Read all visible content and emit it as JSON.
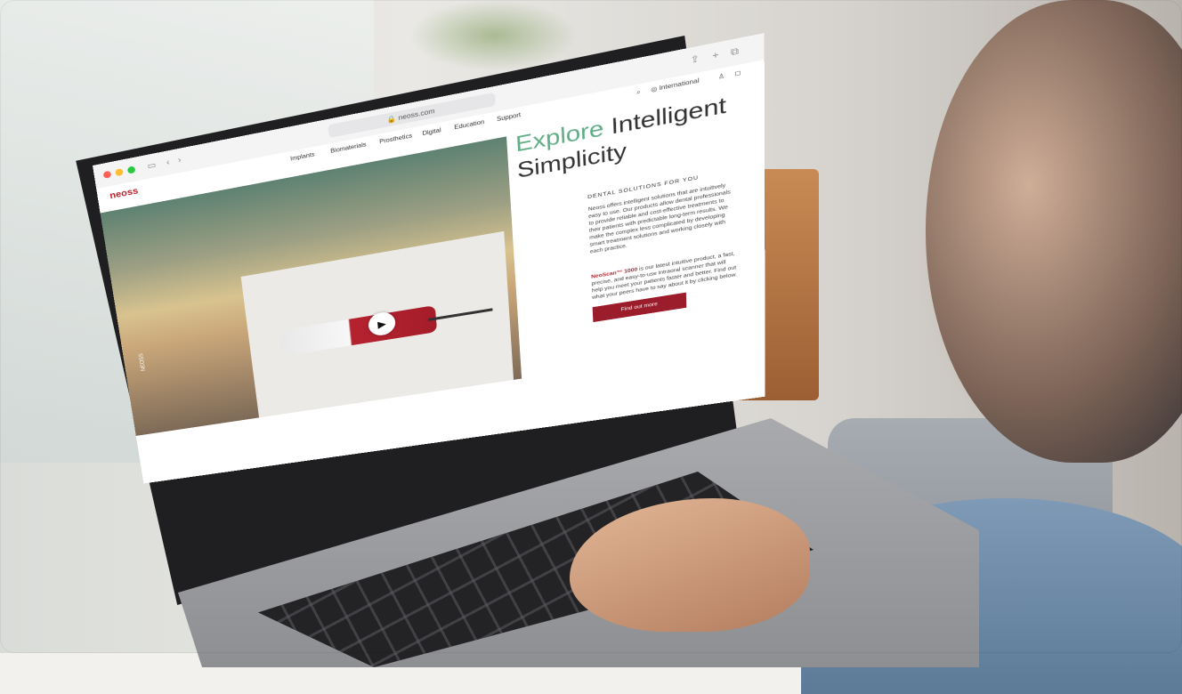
{
  "browser": {
    "url": "neoss.com",
    "reader_icon": "reader-icon"
  },
  "site": {
    "logo_text": "neoss",
    "nav": [
      "Implants",
      "Biomaterials",
      "Prosthetics",
      "Digital",
      "Education",
      "Support"
    ],
    "header_right": {
      "search_icon": "search-icon",
      "region": "International",
      "account_icon": "user-icon",
      "cart_icon": "cart-icon"
    }
  },
  "hero": {
    "headline_accent": "Explore",
    "headline_rest": "Intelligent",
    "headline_line2": "Simplicity",
    "vertical_label": "NEOSS",
    "eyebrow": "DENTAL SOLUTIONS FOR YOU",
    "paragraph1": "Neoss offers intelligent solutions that are intuitively easy to use. Our products allow dental professionals to provide reliable and cost-effective treatments to their patients with predictable long-term results. We make the complex less complicated by developing smart treatment solutions and working closely with each practice.",
    "paragraph2_brand": "NeoScan™ 1000",
    "paragraph2_rest": " is our latest intuitive product, a fast, precise, and easy-to-use intraoral scanner that will help you meet your patients faster and better. Find out what your peers have to say about it by clicking below.",
    "cta_label": "Find out more"
  },
  "colors": {
    "brand": "#b5222f",
    "accent": "#5fae86",
    "cta": "#9b1c2a"
  }
}
